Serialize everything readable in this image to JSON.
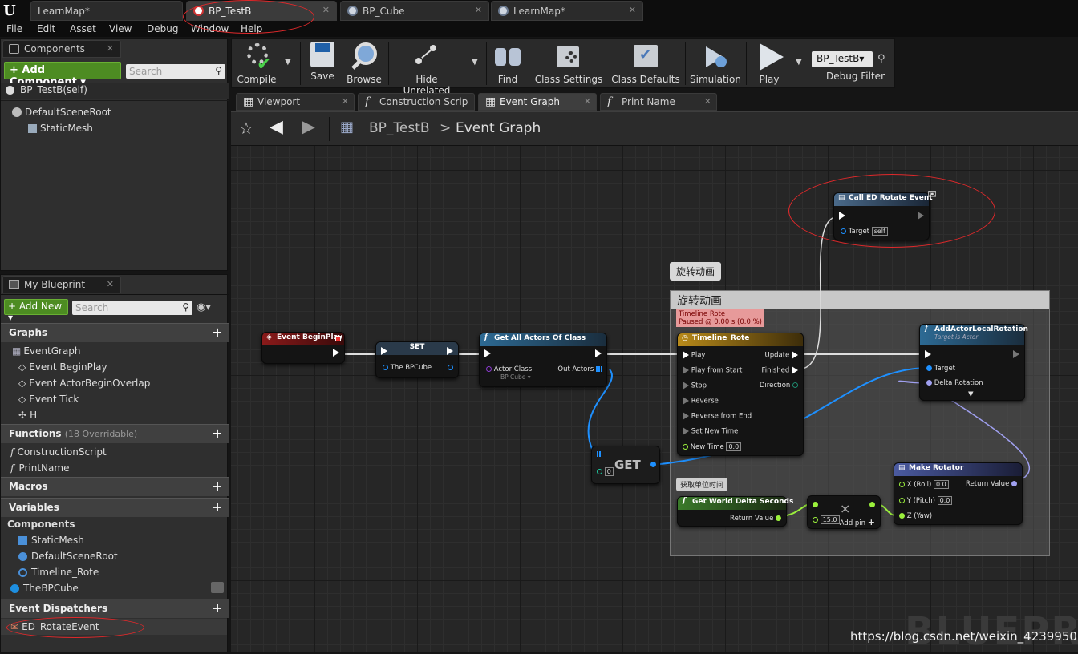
{
  "doc_tabs": [
    {
      "label": "LearnMap*",
      "active": false
    },
    {
      "label": "BP_TestB",
      "active": true
    },
    {
      "label": "BP_Cube",
      "active": false
    },
    {
      "label": "LearnMap*",
      "active": false
    }
  ],
  "menu": [
    "File",
    "Edit",
    "Asset",
    "View",
    "Debug",
    "Window",
    "Help"
  ],
  "components_panel": {
    "title": "Components",
    "add_button": "+ Add Component",
    "search_placeholder": "Search",
    "self_item": "BP_TestB(self)",
    "tree": [
      "DefaultSceneRoot",
      "StaticMesh"
    ]
  },
  "my_blueprint": {
    "title": "My Blueprint",
    "add_new": "+ Add New",
    "search_placeholder": "Search",
    "graphs_header": "Graphs",
    "graphs": [
      "EventGraph",
      "Event BeginPlay",
      "Event ActorBeginOverlap",
      "Event Tick",
      "H"
    ],
    "functions_header": "Functions",
    "functions_sub": "(18 Overridable)",
    "functions": [
      "ConstructionScript",
      "PrintName"
    ],
    "macros_header": "Macros",
    "variables_header": "Variables",
    "components_sub": "Components",
    "variables": [
      "StaticMesh",
      "DefaultSceneRoot",
      "Timeline_Rote",
      "TheBPCube"
    ],
    "dispatchers_header": "Event Dispatchers",
    "dispatchers": [
      "ED_RotateEvent"
    ]
  },
  "toolbar": {
    "compile": "Compile",
    "save": "Save",
    "browse": "Browse",
    "hide_unrelated": "Hide Unrelated",
    "find": "Find",
    "class_settings": "Class Settings",
    "class_defaults": "Class Defaults",
    "simulation": "Simulation",
    "play": "Play",
    "debug_object": "BP_TestB▾",
    "debug_filter": "Debug Filter"
  },
  "editor_tabs": [
    "Viewport",
    "Construction Scrip",
    "Event Graph",
    "Print Name"
  ],
  "breadcrumb": {
    "root": "BP_TestB",
    "separator": ">",
    "current": "Event Graph"
  },
  "graph": {
    "comment_bubble": "旋转动画",
    "comment_title": "旋转动画",
    "timeline_status_1": "Timeline Rote",
    "timeline_status_2": "Paused @ 0.00 s (0.0 %)",
    "nodes": {
      "begin_play": {
        "title": "Event BeginPlay"
      },
      "set": {
        "title": "SET",
        "pin": "The BPCube"
      },
      "get_all": {
        "title": "Get All Actors Of Class",
        "pin_class": "Actor Class",
        "class_value": "BP Cube ▾",
        "pin_out": "Out Actors"
      },
      "timeline": {
        "title": "Timeline_Rote",
        "inputs": [
          "Play",
          "Play from Start",
          "Stop",
          "Reverse",
          "Reverse from End",
          "Set New Time",
          "New Time"
        ],
        "new_time_value": "0.0",
        "outputs": [
          "Update",
          "Finished",
          "Direction"
        ]
      },
      "call_ed": {
        "title": "Call ED Rotate Event",
        "pin": "Target",
        "pin_value": "self"
      },
      "add_rot": {
        "title": "AddActorLocalRotation",
        "subtitle": "Target is Actor",
        "pin_target": "Target",
        "pin_delta": "Delta Rotation"
      },
      "get": {
        "title": "GET",
        "index": "0"
      },
      "get_world": {
        "title": "Get World Delta Seconds",
        "pin": "Return Value"
      },
      "multiply": {
        "symbol": "×",
        "value": "15.0",
        "add_pin": "Add pin"
      },
      "make_rotator": {
        "title": "Make Rotator",
        "x": "X (Roll)",
        "x_val": "0.0",
        "y": "Y (Pitch)",
        "y_val": "0.0",
        "z": "Z (Yaw)",
        "out": "Return Value"
      },
      "sub_comment": "获取单位时间"
    },
    "watermark": "BLUEPRI",
    "url": "https://blog.csdn.net/weixin_42399500"
  }
}
